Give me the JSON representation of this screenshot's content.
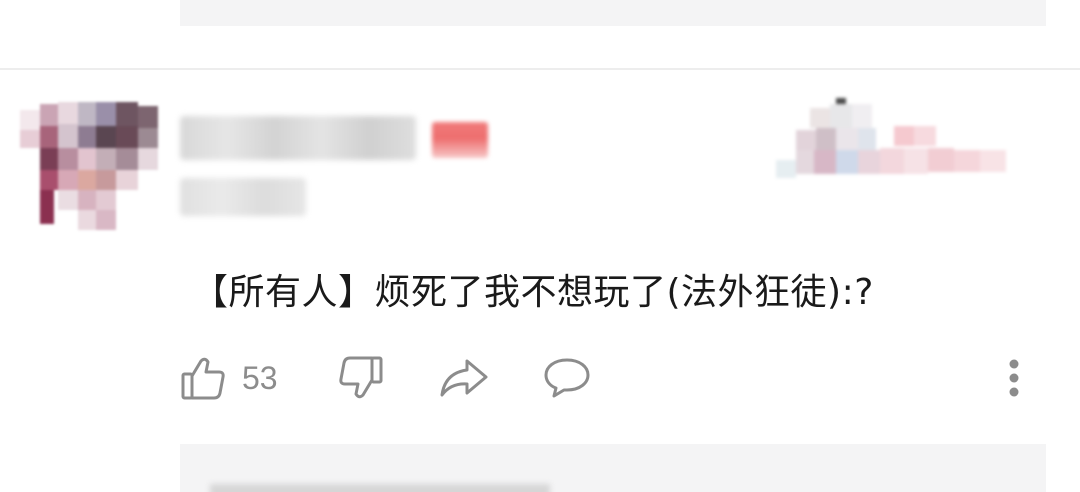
{
  "comment": {
    "text": "【所有人】烦死了我不想玩了(法外狂徒):?",
    "like_count": "53"
  },
  "icons": {
    "like": "thumbs-up-icon",
    "dislike": "thumbs-down-icon",
    "share": "share-arrow-icon",
    "reply": "speech-bubble-icon",
    "more": "more-vertical-icon"
  },
  "colors": {
    "text": "#1a1a1a",
    "icon": "#8c8c8c",
    "badge": "#ee6e6e",
    "reply_background": "#f4f4f5"
  }
}
